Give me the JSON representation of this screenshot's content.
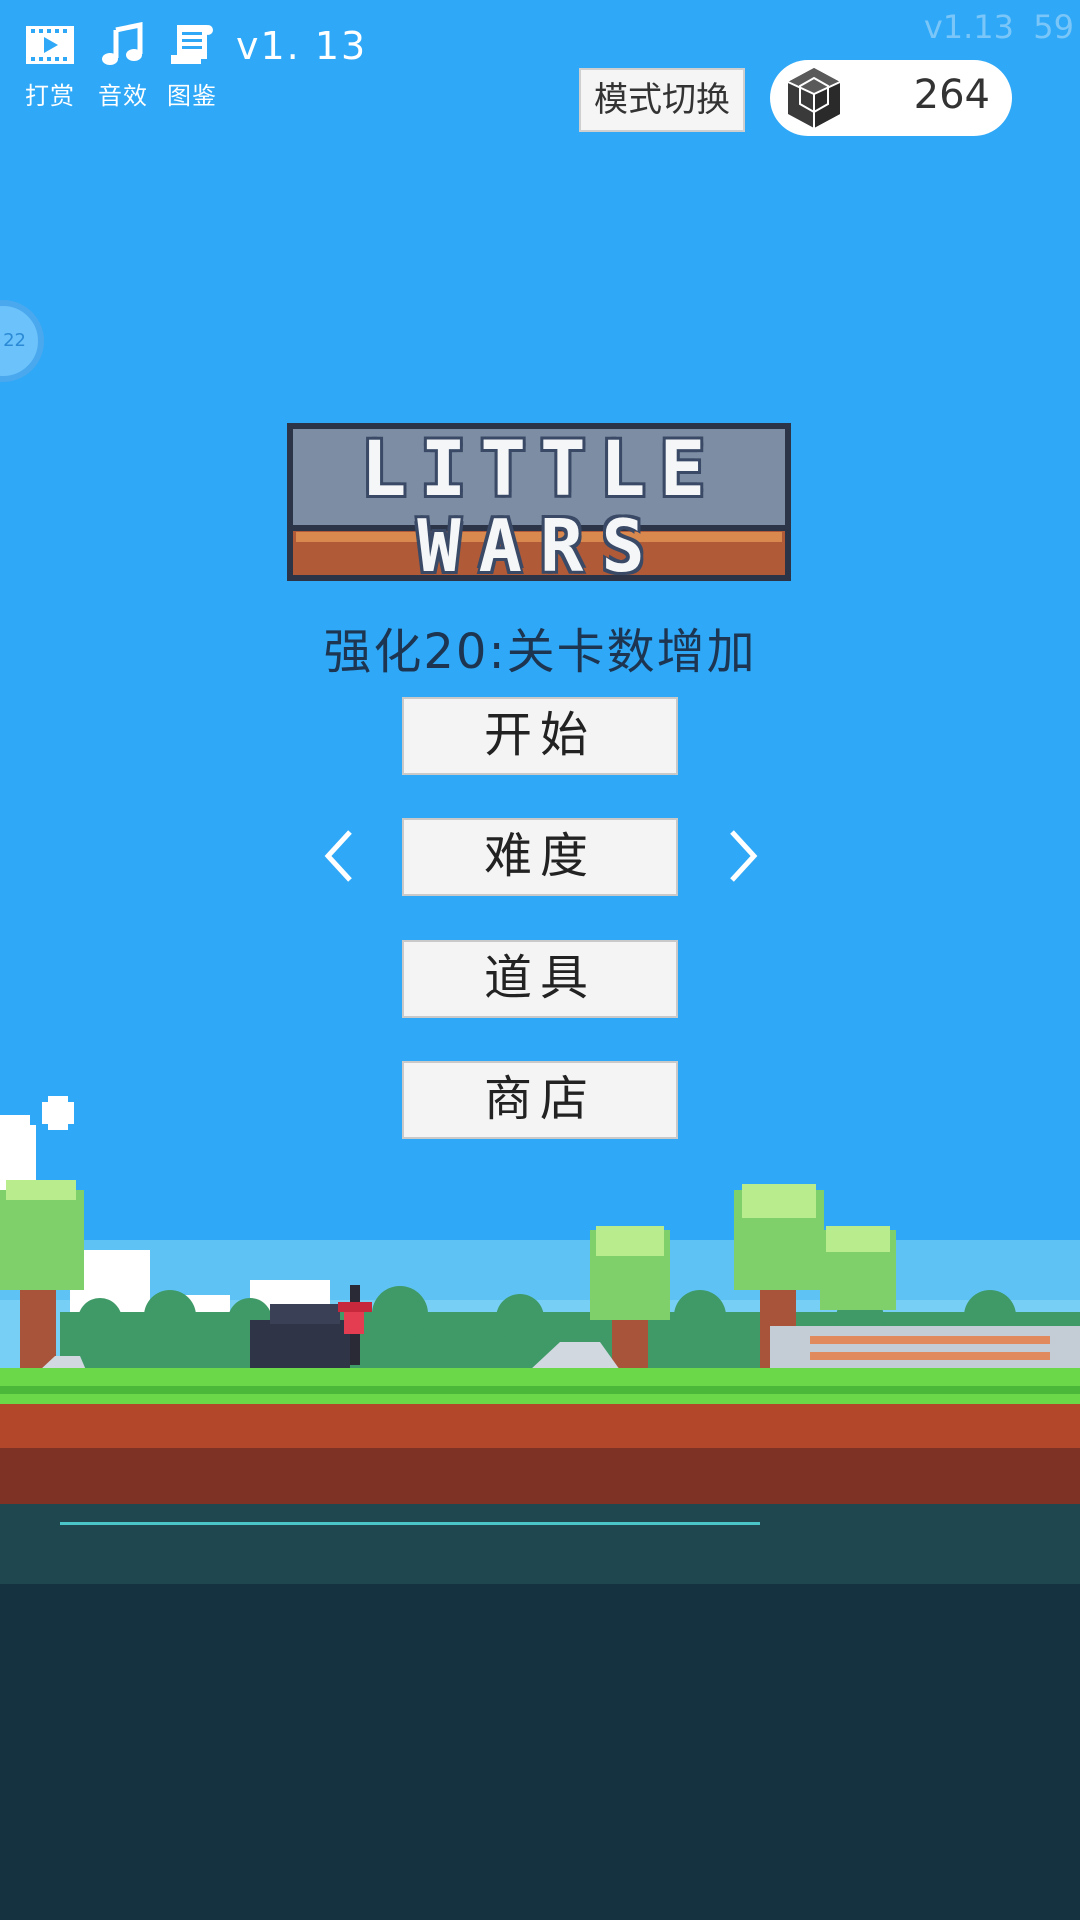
{
  "toolbar": {
    "items": [
      {
        "label": "打赏",
        "icon": "film-icon"
      },
      {
        "label": "音效",
        "icon": "music-icon"
      },
      {
        "label": "图鉴",
        "icon": "scroll-icon"
      }
    ],
    "version": "v1. 13"
  },
  "status": {
    "version": "v1.13",
    "fps": "59"
  },
  "mode_switch_label": "模式切换",
  "currency": {
    "icon": "gem-icon",
    "count": "264"
  },
  "side_ball_text": "22",
  "logo": {
    "line1": "LITTLE",
    "line2": "WARS"
  },
  "subtitle": "强化20:关卡数增加",
  "menu": {
    "start": "开始",
    "difficulty": "难度",
    "items": "道具",
    "shop": "商店"
  },
  "colors": {
    "sky": "#2ea8f7",
    "grass": "#6bd84a",
    "dirt": "#b2472a",
    "water": "#1f4750"
  }
}
